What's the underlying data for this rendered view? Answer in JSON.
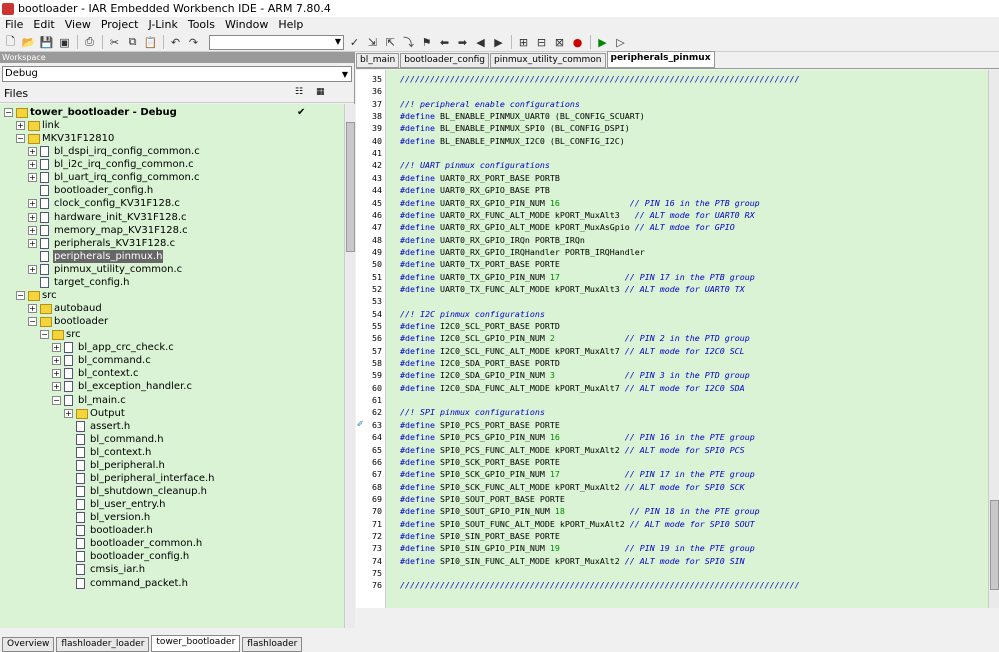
{
  "window": {
    "title": "bootloader - IAR Embedded Workbench IDE - ARM 7.80.4"
  },
  "menu": [
    "File",
    "Edit",
    "View",
    "Project",
    "J-Link",
    "Tools",
    "Window",
    "Help"
  ],
  "toolbar": {
    "combo_value": ""
  },
  "workspace": {
    "panel_title": "Workspace",
    "config": "Debug",
    "files_header": "Files",
    "check_col": "✔"
  },
  "tree": [
    {
      "depth": 0,
      "kind": "folder",
      "exp": "−",
      "label": "tower_bootloader - Debug",
      "bold": true,
      "check": true
    },
    {
      "depth": 1,
      "kind": "folder",
      "exp": "+",
      "label": "link"
    },
    {
      "depth": 1,
      "kind": "folder",
      "exp": "−",
      "label": "MKV31F12810"
    },
    {
      "depth": 2,
      "kind": "file",
      "exp": "+",
      "label": "bl_dspi_irq_config_common.c"
    },
    {
      "depth": 2,
      "kind": "file",
      "exp": "+",
      "label": "bl_i2c_irq_config_common.c"
    },
    {
      "depth": 2,
      "kind": "file",
      "exp": "+",
      "label": "bl_uart_irq_config_common.c"
    },
    {
      "depth": 2,
      "kind": "file",
      "exp": "",
      "label": "bootloader_config.h"
    },
    {
      "depth": 2,
      "kind": "file",
      "exp": "+",
      "label": "clock_config_KV31F128.c"
    },
    {
      "depth": 2,
      "kind": "file",
      "exp": "+",
      "label": "hardware_init_KV31F128.c"
    },
    {
      "depth": 2,
      "kind": "file",
      "exp": "+",
      "label": "memory_map_KV31F128.c"
    },
    {
      "depth": 2,
      "kind": "file",
      "exp": "+",
      "label": "peripherals_KV31F128.c"
    },
    {
      "depth": 2,
      "kind": "file",
      "exp": "",
      "label": "peripherals_pinmux.h",
      "selected": true
    },
    {
      "depth": 2,
      "kind": "file",
      "exp": "+",
      "label": "pinmux_utility_common.c"
    },
    {
      "depth": 2,
      "kind": "file",
      "exp": "",
      "label": "target_config.h"
    },
    {
      "depth": 1,
      "kind": "folder",
      "exp": "−",
      "label": "src"
    },
    {
      "depth": 2,
      "kind": "folder",
      "exp": "+",
      "label": "autobaud"
    },
    {
      "depth": 2,
      "kind": "folder",
      "exp": "−",
      "label": "bootloader"
    },
    {
      "depth": 3,
      "kind": "folder",
      "exp": "−",
      "label": "src"
    },
    {
      "depth": 4,
      "kind": "file",
      "exp": "+",
      "label": "bl_app_crc_check.c"
    },
    {
      "depth": 4,
      "kind": "file",
      "exp": "+",
      "label": "bl_command.c"
    },
    {
      "depth": 4,
      "kind": "file",
      "exp": "+",
      "label": "bl_context.c"
    },
    {
      "depth": 4,
      "kind": "file",
      "exp": "+",
      "label": "bl_exception_handler.c"
    },
    {
      "depth": 4,
      "kind": "file",
      "exp": "−",
      "label": "bl_main.c"
    },
    {
      "depth": 5,
      "kind": "folder",
      "exp": "+",
      "label": "Output"
    },
    {
      "depth": 5,
      "kind": "file",
      "exp": "",
      "label": "assert.h"
    },
    {
      "depth": 5,
      "kind": "file",
      "exp": "",
      "label": "bl_command.h"
    },
    {
      "depth": 5,
      "kind": "file",
      "exp": "",
      "label": "bl_context.h"
    },
    {
      "depth": 5,
      "kind": "file",
      "exp": "",
      "label": "bl_peripheral.h"
    },
    {
      "depth": 5,
      "kind": "file",
      "exp": "",
      "label": "bl_peripheral_interface.h"
    },
    {
      "depth": 5,
      "kind": "file",
      "exp": "",
      "label": "bl_shutdown_cleanup.h"
    },
    {
      "depth": 5,
      "kind": "file",
      "exp": "",
      "label": "bl_user_entry.h"
    },
    {
      "depth": 5,
      "kind": "file",
      "exp": "",
      "label": "bl_version.h"
    },
    {
      "depth": 5,
      "kind": "file",
      "exp": "",
      "label": "bootloader.h"
    },
    {
      "depth": 5,
      "kind": "file",
      "exp": "",
      "label": "bootloader_common.h"
    },
    {
      "depth": 5,
      "kind": "file",
      "exp": "",
      "label": "bootloader_config.h"
    },
    {
      "depth": 5,
      "kind": "file",
      "exp": "",
      "label": "cmsis_iar.h"
    },
    {
      "depth": 5,
      "kind": "file",
      "exp": "",
      "label": "command_packet.h"
    }
  ],
  "bottom_tabs": [
    "Overview",
    "flashloader_loader",
    "tower_bootloader",
    "flashloader"
  ],
  "bottom_active": 2,
  "editor_tabs": [
    "bl_main",
    "bootloader_config",
    "pinmux_utility_common",
    "peripherals_pinmux"
  ],
  "editor_active": 3,
  "code": [
    {
      "n": "35",
      "t": "c",
      "s": "////////////////////////////////////////////////////////////////////////////////"
    },
    {
      "n": "36",
      "t": "",
      "s": ""
    },
    {
      "n": "37",
      "t": "c",
      "s": "//! peripheral enable configurations"
    },
    {
      "n": "38",
      "t": "d",
      "s": "BL_ENABLE_PINMUX_UART0 (BL_CONFIG_SCUART)"
    },
    {
      "n": "39",
      "t": "d",
      "s": "BL_ENABLE_PINMUX_SPI0 (BL_CONFIG_DSPI)"
    },
    {
      "n": "40",
      "t": "d",
      "s": "BL_ENABLE_PINMUX_I2C0 (BL_CONFIG_I2C)"
    },
    {
      "n": "41",
      "t": "",
      "s": ""
    },
    {
      "n": "42",
      "t": "c",
      "s": "//! UART pinmux configurations"
    },
    {
      "n": "43",
      "t": "d",
      "s": "UART0_RX_PORT_BASE PORTB"
    },
    {
      "n": "44",
      "t": "d",
      "s": "UART0_RX_GPIO_BASE PTB"
    },
    {
      "n": "45",
      "t": "d",
      "s": "UART0_RX_GPIO_PIN_NUM ",
      "num": "16",
      "c": "              // PIN 16 in the PTB group"
    },
    {
      "n": "46",
      "t": "d",
      "s": "UART0_RX_FUNC_ALT_MODE kPORT_MuxAlt3",
      "c": "   // ALT mode for UART0 RX"
    },
    {
      "n": "47",
      "t": "d",
      "s": "UART0_RX_GPIO_ALT_MODE kPORT_MuxAsGpio",
      "c": " // ALT mdoe for GPIO"
    },
    {
      "n": "48",
      "t": "d",
      "s": "UART0_RX_GPIO_IRQn PORTB_IRQn"
    },
    {
      "n": "49",
      "t": "d",
      "s": "UART0_RX_GPIO_IRQHandler PORTB_IRQHandler"
    },
    {
      "n": "50",
      "t": "d",
      "s": "UART0_TX_PORT_BASE PORTE"
    },
    {
      "n": "51",
      "t": "d",
      "s": "UART0_TX_GPIO_PIN_NUM ",
      "num": "17",
      "c": "             // PIN 17 in the PTB group"
    },
    {
      "n": "52",
      "t": "d",
      "s": "UART0_TX_FUNC_ALT_MODE kPORT_MuxAlt3",
      "c": " // ALT mode for UART0 TX"
    },
    {
      "n": "53",
      "t": "",
      "s": ""
    },
    {
      "n": "54",
      "t": "c",
      "s": "//! I2C pinmux configurations"
    },
    {
      "n": "55",
      "t": "d",
      "s": "I2C0_SCL_PORT_BASE PORTD"
    },
    {
      "n": "56",
      "t": "d",
      "s": "I2C0_SCL_GPIO_PIN_NUM ",
      "num": "2",
      "c": "              // PIN 2 in the PTD group"
    },
    {
      "n": "57",
      "t": "d",
      "s": "I2C0_SCL_FUNC_ALT_MODE kPORT_MuxAlt7",
      "c": " // ALT mode for I2C0 SCL"
    },
    {
      "n": "58",
      "t": "d",
      "s": "I2C0_SDA_PORT_BASE PORTD"
    },
    {
      "n": "59",
      "t": "d",
      "s": "I2C0_SDA_GPIO_PIN_NUM ",
      "num": "3",
      "c": "              // PIN 3 in the PTD group"
    },
    {
      "n": "60",
      "t": "d",
      "s": "I2C0_SDA_FUNC_ALT_MODE kPORT_MuxAlt7",
      "c": " // ALT mode for I2C0 SDA"
    },
    {
      "n": "61",
      "t": "",
      "s": ""
    },
    {
      "n": "62",
      "t": "c",
      "s": "//! SPI pinmux configurations"
    },
    {
      "n": "63",
      "t": "d",
      "s": "SPI0_PCS_PORT_BASE PORTE",
      "bm": true
    },
    {
      "n": "64",
      "t": "d",
      "s": "SPI0_PCS_GPIO_PIN_NUM ",
      "num": "16",
      "c": "             // PIN 16 in the PTE group"
    },
    {
      "n": "65",
      "t": "d",
      "s": "SPI0_PCS_FUNC_ALT_MODE kPORT_MuxAlt2",
      "c": " // ALT mode for SPI0 PCS"
    },
    {
      "n": "66",
      "t": "d",
      "s": "SPI0_SCK_PORT_BASE PORTE"
    },
    {
      "n": "67",
      "t": "d",
      "s": "SPI0_SCK_GPIO_PIN_NUM ",
      "num": "17",
      "c": "             // PIN 17 in the PTE group"
    },
    {
      "n": "68",
      "t": "d",
      "s": "SPI0_SCK_FUNC_ALT_MODE kPORT_MuxAlt2",
      "c": " // ALT mode for SPI0 SCK"
    },
    {
      "n": "69",
      "t": "d",
      "s": "SPI0_SOUT_PORT_BASE PORTE"
    },
    {
      "n": "70",
      "t": "d",
      "s": "SPI0_SOUT_GPIO_PIN_NUM ",
      "num": "18",
      "c": "             // PIN 18 in the PTE group"
    },
    {
      "n": "71",
      "t": "d",
      "s": "SPI0_SOUT_FUNC_ALT_MODE kPORT_MuxAlt2",
      "c": " // ALT mode for SPI0 SOUT"
    },
    {
      "n": "72",
      "t": "d",
      "s": "SPI0_SIN_PORT_BASE PORTE"
    },
    {
      "n": "73",
      "t": "d",
      "s": "SPI0_SIN_GPIO_PIN_NUM ",
      "num": "19",
      "c": "             // PIN 19 in the PTE group"
    },
    {
      "n": "74",
      "t": "d",
      "s": "SPI0_SIN_FUNC_ALT_MODE kPORT_MuxAlt2",
      "c": " // ALT mode for SPI0 SIN"
    },
    {
      "n": "75",
      "t": "",
      "s": ""
    },
    {
      "n": "76",
      "t": "c",
      "s": "////////////////////////////////////////////////////////////////////////////////"
    }
  ],
  "colors": {
    "editor_bg": "#d9f3d4",
    "keyword": "#0000cc",
    "number": "#008800",
    "selection": "#666666"
  }
}
